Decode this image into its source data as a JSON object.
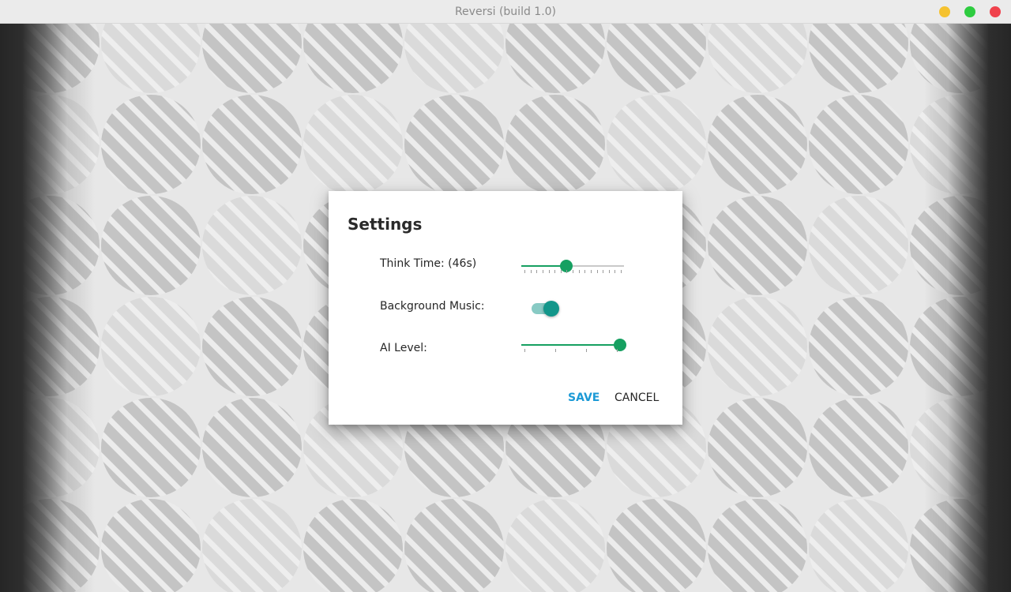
{
  "window": {
    "title": "Reversi (build 1.0)",
    "controls": {
      "minimize_color": "#f5c230",
      "maximize_color": "#2ecc40",
      "close_color": "#f0424c"
    }
  },
  "dialog": {
    "title": "Settings",
    "think_time": {
      "label": "Think Time: (46s)",
      "fraction": 0.44
    },
    "background_music": {
      "label": "Background Music:",
      "enabled": true
    },
    "ai_level": {
      "label": "AI Level:",
      "fraction": 1.0
    },
    "buttons": {
      "save": "SAVE",
      "cancel": "CANCEL"
    }
  },
  "colors": {
    "slider_green": "#16a061",
    "toggle_teal": "#12968a",
    "save_blue": "#1c9ad6"
  }
}
